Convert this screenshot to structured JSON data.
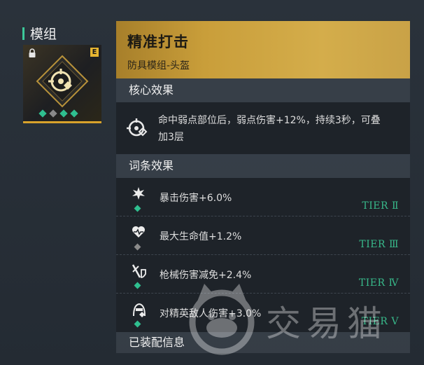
{
  "left": {
    "title": "模组",
    "grade": "E"
  },
  "module": {
    "name": "精准打击",
    "type": "防具模组-头盔"
  },
  "core": {
    "title": "核心效果",
    "description": "命中弱点部位后，弱点伤害+12%，持续3秒，可叠加3层"
  },
  "affixes": {
    "title": "词条效果",
    "items": [
      {
        "label": "暴击伤害+6.0%",
        "tier": "TIER Ⅱ",
        "icon": "crit-burst-icon"
      },
      {
        "label": "最大生命值+1.2%",
        "tier": "TIER Ⅲ",
        "icon": "heart-pulse-icon"
      },
      {
        "label": "枪械伤害减免+2.4%",
        "tier": "TIER Ⅳ",
        "icon": "gun-shield-icon"
      },
      {
        "label": "对精英敌人伤害+3.0%",
        "tier": "TIER Ⅴ",
        "icon": "elite-enemy-icon"
      }
    ]
  },
  "equipped": {
    "title": "已装配信息"
  },
  "watermark": {
    "text": "交易猫"
  },
  "colors": {
    "accent_green": "#38b98a",
    "gold": "#d4ad4b"
  }
}
